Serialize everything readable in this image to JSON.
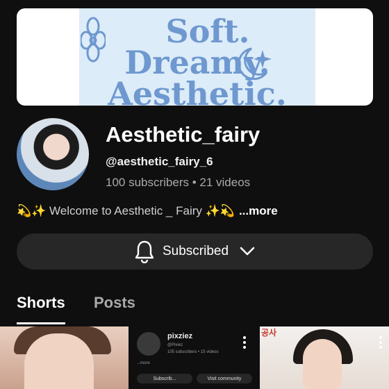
{
  "banner": {
    "line1": "Soft.",
    "line2": "Dreamy.",
    "line3": "Aesthetic."
  },
  "channel": {
    "name": "Aesthetic_fairy",
    "handle": "@aesthetic_fairy_6",
    "stats": "100 subscribers • 21 videos",
    "description": "💫✨ Welcome to Aesthetic _ Fairy ✨💫",
    "more_label": "...more"
  },
  "subscribe_button": {
    "label": "Subscribed",
    "icon": "bell-icon"
  },
  "tabs": [
    {
      "label": "Shorts",
      "active": true
    },
    {
      "label": "Posts",
      "active": false
    }
  ],
  "shorts": [
    {
      "kind": "photo"
    },
    {
      "kind": "screenshot",
      "name": "pixziez",
      "handle": "@Pixiez",
      "stats": "105 subscribers • 15 videos",
      "more": "...more",
      "button1": "Subscrib...",
      "button2": "Visit community"
    },
    {
      "kind": "photo",
      "sign_text": "공사"
    }
  ],
  "colors": {
    "background": "#0f0f0f",
    "button_bg": "#272727",
    "muted_text": "#aaaaaa",
    "banner_text": "#6e98cf"
  }
}
